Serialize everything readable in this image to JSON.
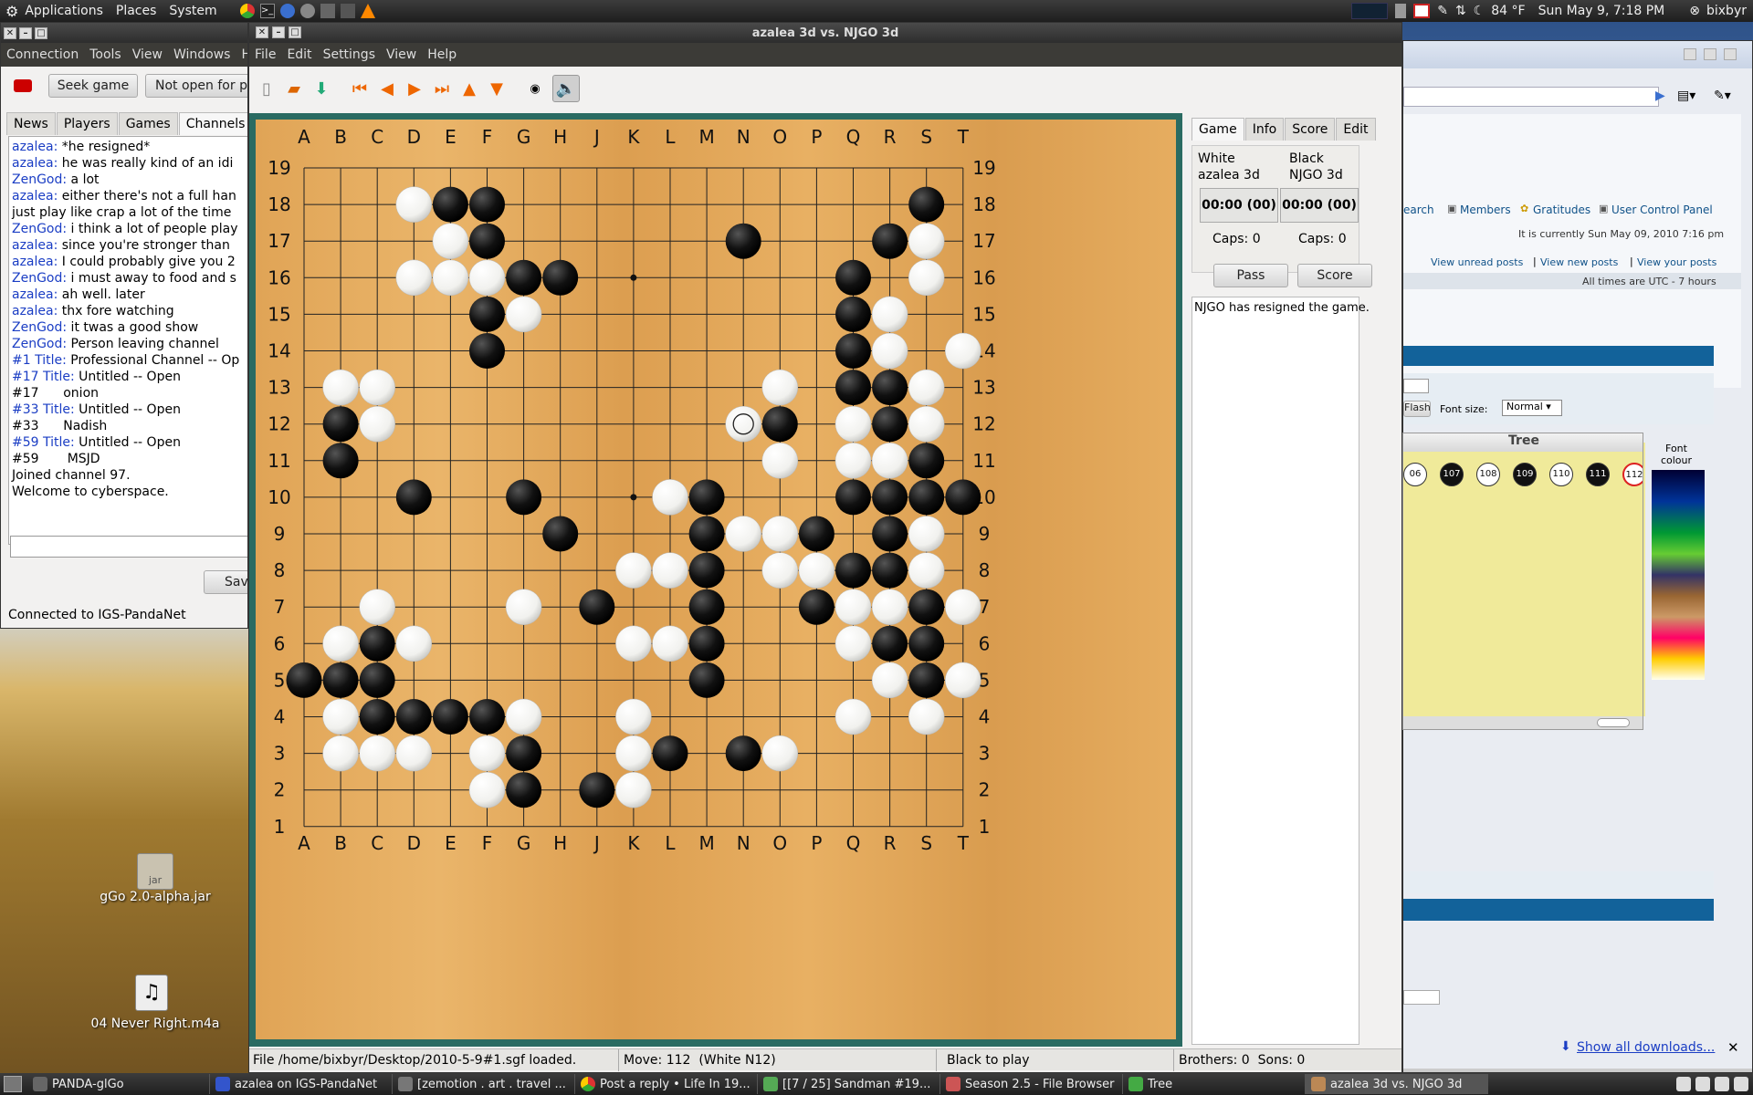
{
  "top_panel": {
    "menus": [
      "Applications",
      "Places",
      "System"
    ],
    "weather": "84 °F",
    "clock": "Sun May 9, 7:18 PM",
    "user": "bixbyr"
  },
  "client_window": {
    "menus": [
      "Connection",
      "Tools",
      "View",
      "Windows",
      "Hel"
    ],
    "seek_button": "Seek game",
    "open_button": "Not open for pla",
    "tabs": [
      "News",
      "Players",
      "Games",
      "Channels"
    ],
    "chat": [
      {
        "nick": "azalea:",
        "text": " *he resigned*"
      },
      {
        "nick": "azalea:",
        "text": " he was really kind of an idi"
      },
      {
        "nick": "ZenGod:",
        "text": " a lot"
      },
      {
        "nick": "azalea:",
        "text": " either there's not a full han"
      },
      {
        "nick": "",
        "text": "just play like crap a lot of the time"
      },
      {
        "nick": "ZenGod:",
        "text": " i think a lot of people play"
      },
      {
        "nick": "azalea:",
        "text": " since you're stronger than"
      },
      {
        "nick": "azalea:",
        "text": " I could probably give you 2"
      },
      {
        "nick": "ZenGod:",
        "text": " i must away to food and s"
      },
      {
        "nick": "azalea:",
        "text": " ah well. later"
      },
      {
        "nick": "azalea:",
        "text": " thx fore watching"
      },
      {
        "nick": "ZenGod:",
        "text": " it twas a good show"
      },
      {
        "nick": "ZenGod:",
        "text": " Person leaving channel"
      },
      {
        "nick": "#1 Title:",
        "text": " Professional Channel -- Op"
      },
      {
        "nick": "#17 Title:",
        "text": " Untitled -- Open"
      },
      {
        "nick": "",
        "text": "#17      onion"
      },
      {
        "nick": "#33 Title:",
        "text": " Untitled -- Open"
      },
      {
        "nick": "",
        "text": "#33      Nadish"
      },
      {
        "nick": "#59 Title:",
        "text": " Untitled -- Open"
      },
      {
        "nick": "",
        "text": "#59       MSJD"
      },
      {
        "nick": "",
        "text": "Joined channel 97."
      },
      {
        "nick": "",
        "text": "Welcome to cyberspace."
      }
    ],
    "save_button": "Sav",
    "status": "Connected to IGS-PandaNet"
  },
  "game_window": {
    "title": "azalea 3d vs. NJGO 3d",
    "menus": [
      "File",
      "Edit",
      "Settings",
      "View",
      "Help"
    ],
    "col_letters": [
      "A",
      "B",
      "C",
      "D",
      "E",
      "F",
      "G",
      "H",
      "J",
      "K",
      "L",
      "M",
      "N",
      "O",
      "P",
      "Q",
      "R",
      "S",
      "T"
    ],
    "side_tabs": [
      "Game",
      "Info",
      "Score",
      "Edit"
    ],
    "white_label": "White",
    "white_name": "azalea 3d",
    "white_clock": "00:00 (00)",
    "white_caps": "Caps:  0",
    "black_label": "Black",
    "black_name": "NJGO 3d",
    "black_clock": "00:00 (00)",
    "black_caps": "Caps:  0",
    "pass_button": "Pass",
    "score_button": "Score",
    "message": "NJGO has resigned the game.",
    "status_file": "File /home/bixbyr/Desktop/2010-5-9#1.sgf loaded.",
    "status_move": "Move: 112  (White N12)",
    "status_turn": "Black to play",
    "status_tree": "Brothers: 0  Sons: 0",
    "black_stones": [
      "E18",
      "F18",
      "S18",
      "F17",
      "N17",
      "R17",
      "G16",
      "H16",
      "Q16",
      "F15",
      "Q15",
      "F14",
      "Q14",
      "B12",
      "O12",
      "R12",
      "Q13",
      "R13",
      "B11",
      "S11",
      "D10",
      "G10",
      "M10",
      "Q10",
      "R10",
      "S10",
      "T10",
      "H9",
      "M9",
      "P9",
      "R9",
      "M8",
      "Q8",
      "R8",
      "J7",
      "M7",
      "P7",
      "S7",
      "C6",
      "M6",
      "R6",
      "S6",
      "A5",
      "B5",
      "C5",
      "M5",
      "S5",
      "C4",
      "D4",
      "E4",
      "F4",
      "G3",
      "L3",
      "N3",
      "G2",
      "J2"
    ],
    "white_stones": [
      "D18",
      "E17",
      "S17",
      "D16",
      "E16",
      "F16",
      "S16",
      "G15",
      "R15",
      "R14",
      "T14",
      "B13",
      "C13",
      "O13",
      "S13",
      "C12",
      "N12",
      "Q12",
      "S12",
      "O11",
      "Q11",
      "R11",
      "L10",
      "N9",
      "O9",
      "S9",
      "K8",
      "L8",
      "O8",
      "P8",
      "S8",
      "C7",
      "G7",
      "Q7",
      "R7",
      "T7",
      "B6",
      "D6",
      "K6",
      "L6",
      "Q6",
      "R5",
      "T5",
      "B4",
      "G4",
      "K4",
      "Q4",
      "S4",
      "B3",
      "C3",
      "D3",
      "F3",
      "K3",
      "O3",
      "F2",
      "K2"
    ],
    "last_move": "N12",
    "hoshi": [
      "K16",
      "K10"
    ]
  },
  "browser": {
    "search": "earch",
    "members": "Members",
    "gratitudes": "Gratitudes",
    "ucp": "User Control Panel",
    "current_time": "It is currently Sun May 09, 2010 7:16 pm",
    "unread": "View unread posts",
    "new_posts": "View new posts",
    "your_posts": "View your posts",
    "utc": "All times are UTC - 7 hours",
    "flash": "Flash",
    "font_size_label": "Font size:",
    "font_size_value": "Normal",
    "tree_title": "Tree",
    "tree_nodes": [
      "06",
      "107",
      "108",
      "109",
      "110",
      "111",
      "112"
    ],
    "font_colour": "Font colour",
    "downloads": "Show all downloads..."
  },
  "desktop_icons": [
    {
      "label": "gGo 2.0-alpha.jar"
    },
    {
      "label": "04 Never Right.m4a"
    }
  ],
  "taskbar": [
    "PANDA-glGo",
    "azalea on IGS-PandaNet",
    "[zemotion . art . travel ...",
    "Post a reply • Life In 19...",
    "[[7 / 25] Sandman #19...",
    "Season 2.5 - File Browser",
    "Tree",
    "azalea 3d vs. NJGO 3d"
  ]
}
